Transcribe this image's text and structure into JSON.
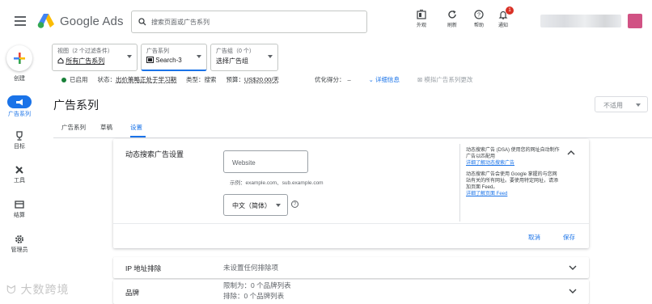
{
  "app": {
    "name": "Google Ads"
  },
  "search": {
    "placeholder": "搜索页面或广告系列"
  },
  "toolbar": {
    "appearance": "外观",
    "refresh": "刷新",
    "help": "帮助",
    "notifications": "通知",
    "notification_count": "1"
  },
  "siderail": {
    "create": "创建",
    "items": [
      {
        "label": "广告系列",
        "icon": "megaphone-icon",
        "active": true
      },
      {
        "label": "目标",
        "icon": "trophy-icon"
      },
      {
        "label": "工具",
        "icon": "wrench-icon"
      },
      {
        "label": "结算",
        "icon": "billing-card-icon"
      },
      {
        "label": "管理员",
        "icon": "gear-icon"
      }
    ]
  },
  "filters": [
    {
      "label": "视图（2 个过滤条件）",
      "value": "所有广告系列",
      "icon": "home-icon"
    },
    {
      "label": "广告系列",
      "value": "Search-3",
      "icon": "campaign-type-icon"
    },
    {
      "label": "广告组（0 个）",
      "value": "选择广告组"
    }
  ],
  "status": {
    "enabled": "已启用",
    "state_label": "状态：",
    "state_value": "出价策略正处于学习期",
    "type_label": "类型：",
    "type_value": "搜索",
    "budget_label": "预算：",
    "budget_value": "US$20.00/天",
    "opt_label": "优化得分：",
    "opt_value": "–",
    "details": "详细信息",
    "simulate": "模拟广告系列更改"
  },
  "page": {
    "title": "广告系列",
    "not_applicable": "不适用"
  },
  "tabs": [
    "广告系列",
    "草稿",
    "设置"
  ],
  "dsa": {
    "title": "动态搜索广告设置",
    "website_placeholder": "Website",
    "example": "示例：example.com、sub.example.com",
    "language": "中文（简体）",
    "help_p1": "动态搜索广告 (DSA) 使用您的网址自动制作广告以匹配用",
    "help_link1": "详细了解动态搜索广告",
    "help_p2": "动态搜索广告会使用 Google 掌握的与您网站有关的所有网址。要使用特定网址，请添加页面 Feed。",
    "help_link2": "详细了解页面 Feed",
    "cancel": "取消",
    "save": "保存"
  },
  "rows": [
    {
      "label": "IP 地址排除",
      "value_lines": [
        "未设置任何排除项"
      ]
    },
    {
      "label": "品牌",
      "value_lines": [
        "限制为：0 个品牌列表",
        "排除：0 个品牌列表"
      ]
    }
  ],
  "watermark": "大数跨境",
  "colors": {
    "accent": "#1a73e8",
    "enabled": "#188038",
    "badge": "#d93025"
  }
}
